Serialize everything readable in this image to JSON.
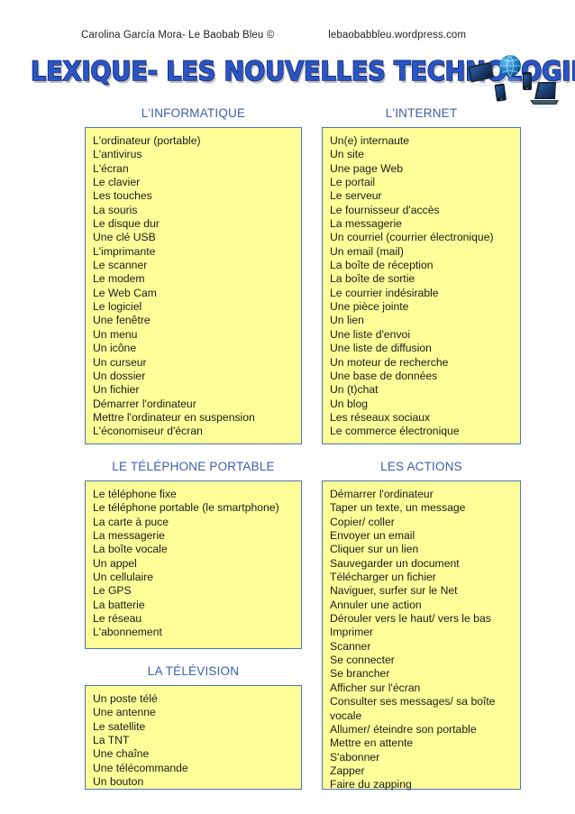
{
  "header": {
    "author": "Carolina García Mora- Le Baobab Bleu ©",
    "site": "lebaobabbleu.wordpress.com"
  },
  "title": {
    "text": "LEXIQUE- LES NOUVELLES TECHNOLOGIES",
    "color": "#2a55c4",
    "outline_color": "#10277a"
  },
  "decoration": {
    "name": "devices-cluster-image",
    "items": [
      "tablet",
      "globe",
      "mobile-phone",
      "smartphone",
      "laptop"
    ]
  },
  "theme": {
    "box_fill": "#ffff99",
    "box_border": "#4a74b8",
    "heading_color": "#3c5eaa",
    "text_color": "#1a1a1a"
  },
  "sections": [
    {
      "id": "informatique",
      "heading": "L'INFORMATIQUE",
      "items": [
        "L'ordinateur (portable)",
        "L'antivirus",
        "L'écran",
        "Le clavier",
        "Les touches",
        "La souris",
        "Le disque dur",
        "Une clé USB",
        "L'imprimante",
        "Le scanner",
        "Le modem",
        "Le Web Cam",
        "Le logiciel",
        "Une fenêtre",
        "Un menu",
        "Un icône",
        "Un curseur",
        "Un dossier",
        "Un fichier",
        "Démarrer l'ordinateur",
        "Mettre l'ordinateur en suspension",
        "L'économiseur d'écran"
      ]
    },
    {
      "id": "internet",
      "heading": "L'INTERNET",
      "items": [
        "Un(e) internaute",
        "Un site",
        "Une page Web",
        "Le portail",
        "Le serveur",
        "Le fournisseur d'accès",
        "La messagerie",
        "Un courriel (courrier électronique)",
        "Un email (mail)",
        "La boîte de réception",
        "La boîte de sortie",
        "Le courrier indésirable",
        "Une pièce jointe",
        "Un lien",
        "Une liste d'envoi",
        "Une liste de diffusion",
        "Un moteur de recherche",
        "Une base de données",
        "Un (t)chat",
        "Un blog",
        "Les réseaux sociaux",
        "Le commerce électronique"
      ]
    },
    {
      "id": "telephone-portable",
      "heading": "LE TÉLÉPHONE PORTABLE",
      "items": [
        "Le téléphone fixe",
        "Le téléphone portable (le smartphone)",
        "La carte à puce",
        "La messagerie",
        "La boîte vocale",
        "Un appel",
        "Un cellulaire",
        "Le GPS",
        "La batterie",
        "Le réseau",
        "L'abonnement"
      ]
    },
    {
      "id": "actions",
      "heading": "LES ACTIONS",
      "items": [
        "Démarrer l'ordinateur",
        "Taper un texte, un message",
        "Copier/ coller",
        "Envoyer un email",
        "Cliquer sur un lien",
        "Sauvegarder un document",
        "Télécharger un fichier",
        "Naviguer, surfer sur le Net",
        "Annuler une action",
        "Dérouler vers le haut/ vers le bas",
        "Imprimer",
        "Scanner",
        "Se connecter",
        "Se brancher",
        "Afficher sur l'écran",
        "Consulter ses messages/ sa boîte vocale",
        "Allumer/ éteindre son portable",
        "Mettre en attente",
        "S'abonner",
        "Zapper",
        "Faire du zapping"
      ]
    },
    {
      "id": "television",
      "heading": "LA TÉLÉVISION",
      "items": [
        "Un poste télé",
        "Une antenne",
        "Le satellite",
        "La TNT",
        "Une chaîne",
        "Une télécommande",
        "Un bouton"
      ]
    }
  ]
}
